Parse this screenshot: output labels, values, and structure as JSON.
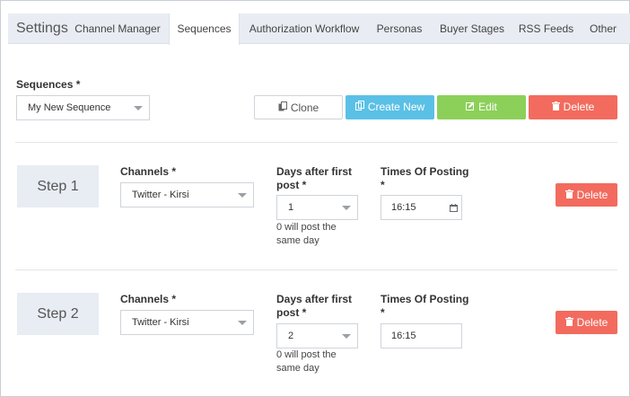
{
  "header": {
    "title": "Settings",
    "tabs": [
      {
        "label": "Channel Manager"
      },
      {
        "label": "Sequences"
      },
      {
        "label": "Authorization Workflow"
      },
      {
        "label": "Personas"
      },
      {
        "label": "Buyer Stages"
      },
      {
        "label": "RSS Feeds"
      },
      {
        "label": "Other"
      }
    ],
    "active_tab": "Sequences"
  },
  "sequence": {
    "label": "Sequences *",
    "selected": "My New Sequence"
  },
  "toolbar": {
    "clone_label": "Clone",
    "create_label": "Create New",
    "edit_label": "Edit",
    "delete_label": "Delete"
  },
  "steps": [
    {
      "title": "Step 1",
      "channels_label": "Channels *",
      "channel": "Twitter - Kirsi",
      "days_label_1": "Days after first",
      "days_label_2": "post *",
      "days": "1",
      "hint_1": "0 will post the",
      "hint_2": "same day",
      "times_label_1": "Times Of Posting",
      "times_label_2": "*",
      "time": "16:15",
      "delete_label": "Delete"
    },
    {
      "title": "Step 2",
      "channels_label": "Channels *",
      "channel": "Twitter - Kirsi",
      "days_label_1": "Days after first",
      "days_label_2": "post *",
      "days": "2",
      "hint_1": "0 will post the",
      "hint_2": "same day",
      "times_label_1": "Times Of Posting",
      "times_label_2": "*",
      "time": "16:15",
      "delete_label": "Delete"
    }
  ],
  "colors": {
    "create": "#5bc0e6",
    "edit": "#8cd05a",
    "delete": "#f26b5e",
    "tabbar": "#e9edf3"
  },
  "icons": {
    "clone": "copy-icon",
    "create": "copy-icon",
    "edit": "edit-icon",
    "delete": "trash-icon",
    "time": "calendar-icon"
  }
}
